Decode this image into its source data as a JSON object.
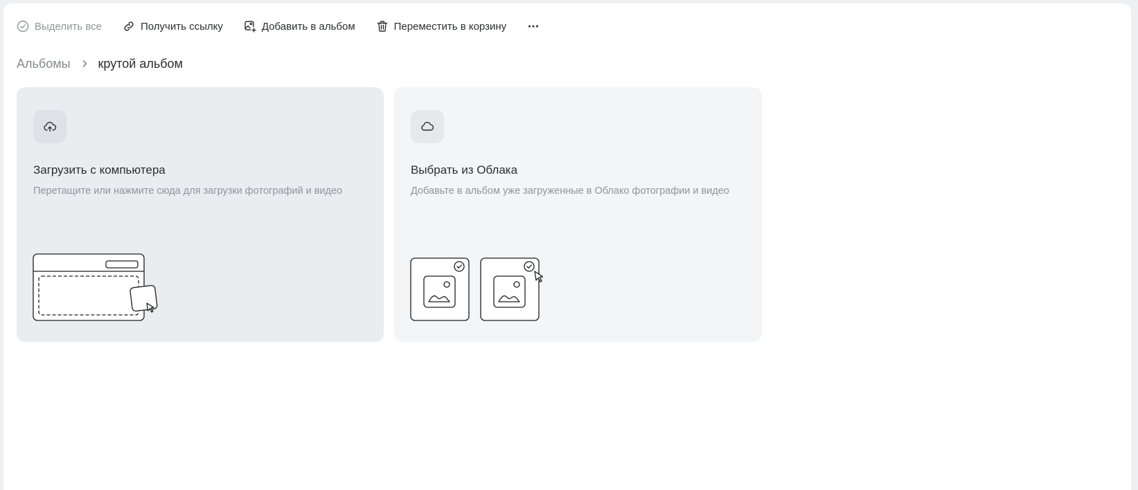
{
  "toolbar": {
    "select_all": "Выделить все",
    "get_link": "Получить ссылку",
    "add_to_album": "Добавить в альбом",
    "move_to_trash": "Переместить в корзину",
    "more_icon": "more-horizontal-icon"
  },
  "breadcrumb": {
    "parent": "Альбомы",
    "current": "крутой альбом"
  },
  "cards": {
    "upload": {
      "icon": "cloud-upload-icon",
      "title": "Загрузить с компьютера",
      "description": "Перетащите или нажмите сюда для загрузки фотографий и видео"
    },
    "cloud": {
      "icon": "cloud-icon",
      "title": "Выбрать из Облака",
      "description": "Добавьте в альбом уже загруженные в Облако фотографии и видео"
    }
  },
  "colors": {
    "text_primary": "#2c2d2e",
    "text_secondary": "#919399",
    "card_upload_bg": "#ebecf0",
    "card_cloud_bg": "#f4f5f7"
  }
}
